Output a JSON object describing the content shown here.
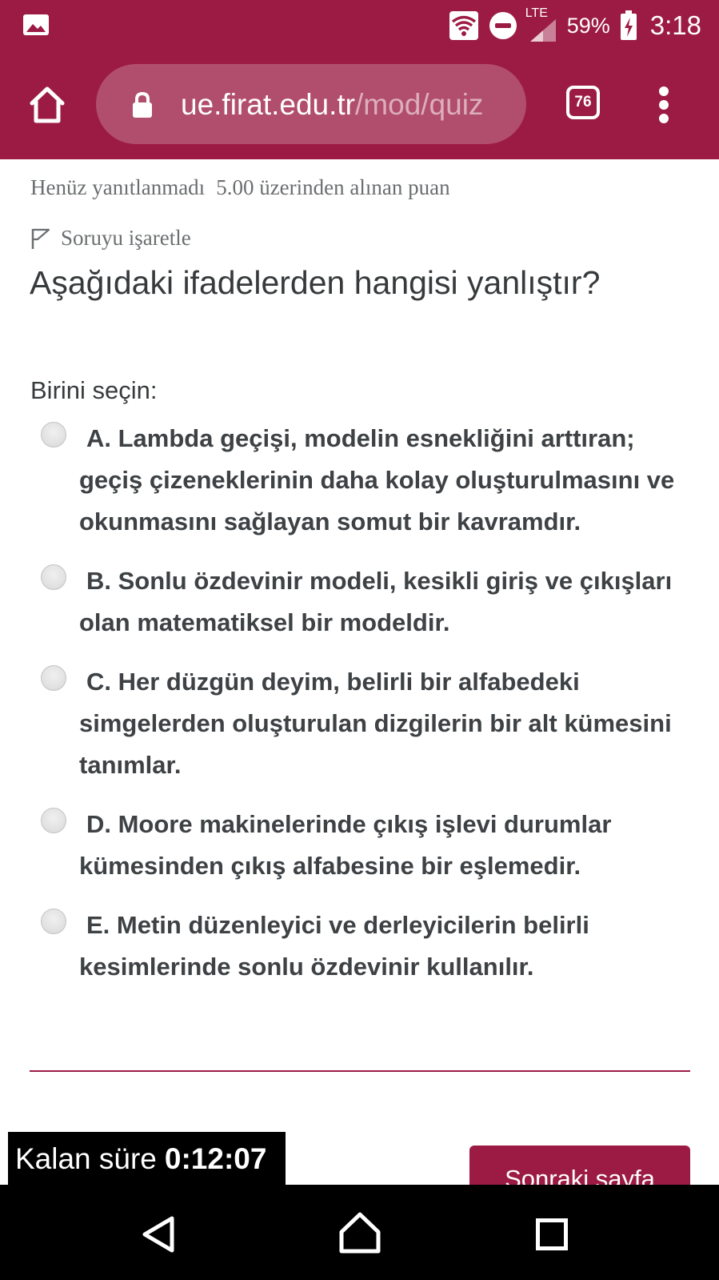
{
  "status_bar": {
    "network": "LTE",
    "battery_percent": "59%",
    "time": "3:18"
  },
  "browser": {
    "url_host": "ue.firat.edu.tr",
    "url_path": "/mod/quiz",
    "tab_count": "76"
  },
  "question_info": {
    "status": "Henüz yanıtlanmadı",
    "points": "5.00 üzerinden alınan puan",
    "flag_label": "Soruyu işaretle"
  },
  "question": {
    "text": "Aşağıdaki ifadelerden hangisi yanlıştır?",
    "prompt": "Birini seçin:",
    "answers": [
      {
        "label": "A. Lambda geçişi, modelin esnekliğini arttıran; geçiş çizeneklerinin daha kolay oluşturulmasını ve okunmasını sağlayan somut bir kavramdır."
      },
      {
        "label": "B. Sonlu özdevinir modeli, kesikli giriş ve çıkışları olan matematiksel bir modeldir."
      },
      {
        "label": "C. Her düzgün deyim, belirli bir alfabedeki simgelerden oluşturulan dizgilerin bir alt kümesini tanımlar."
      },
      {
        "label": "D. Moore makinelerinde çıkış işlevi durumlar kümesinden çıkış alfabesine bir eşlemedir."
      },
      {
        "label": "E. Metin düzenleyici ve derleyicilerin belirli kesimlerinde sonlu özdevinir kullanılır."
      }
    ]
  },
  "timer": {
    "label": "Kalan süre",
    "value": "0:12:07"
  },
  "next_button": "Sonraki sayfa",
  "colors": {
    "brand": "#9c1b45",
    "text": "#373a3c",
    "muted": "#6b6e70"
  }
}
